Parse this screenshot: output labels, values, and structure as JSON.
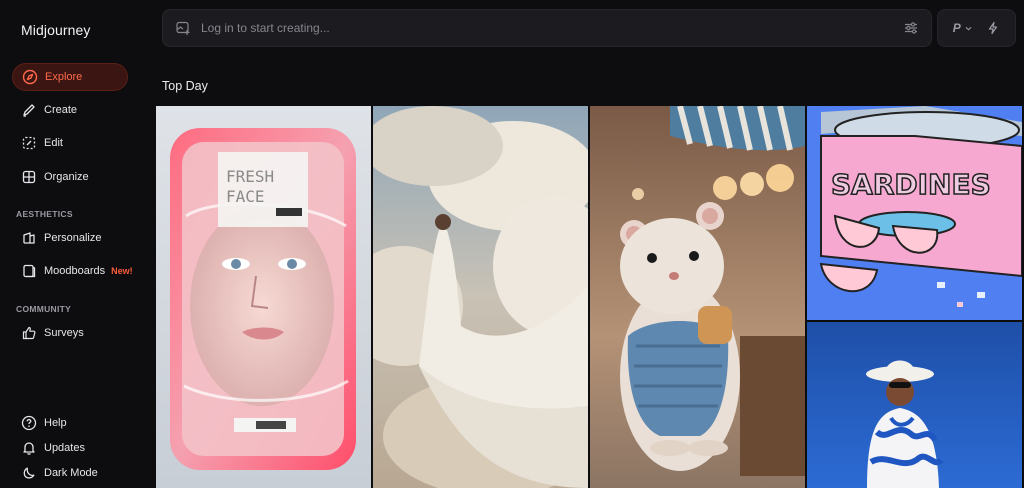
{
  "app": {
    "name": "Midjourney"
  },
  "sidebar": {
    "nav": [
      {
        "label": "Explore",
        "icon": "compass-icon",
        "active": true
      },
      {
        "label": "Create",
        "icon": "brush-icon"
      },
      {
        "label": "Edit",
        "icon": "edit-icon"
      },
      {
        "label": "Organize",
        "icon": "grid-icon"
      }
    ],
    "aesthetics_label": "AESTHETICS",
    "aesthetics": [
      {
        "label": "Personalize",
        "icon": "personalize-icon"
      },
      {
        "label": "Moodboards",
        "icon": "moodboard-icon",
        "badge": "New!"
      }
    ],
    "community_label": "COMMUNITY",
    "community": [
      {
        "label": "Surveys",
        "icon": "thumbs-up-icon"
      }
    ],
    "bottom": [
      {
        "label": "Help",
        "icon": "help-icon"
      },
      {
        "label": "Updates",
        "icon": "bell-icon"
      },
      {
        "label": "Dark Mode",
        "icon": "moon-icon"
      }
    ]
  },
  "search": {
    "placeholder": "Log in to start creating..."
  },
  "mode": {
    "label": "P"
  },
  "content": {
    "heading": "Top Day",
    "gallery_texts": {
      "fresh_1": "FRESH",
      "fresh_2": "FACE",
      "sardines": "SARDINES"
    }
  },
  "colors": {
    "accent": "#ff6a4d",
    "active_bg": "#3a1511",
    "surface": "#1c1c20",
    "background": "#0d0d10"
  }
}
